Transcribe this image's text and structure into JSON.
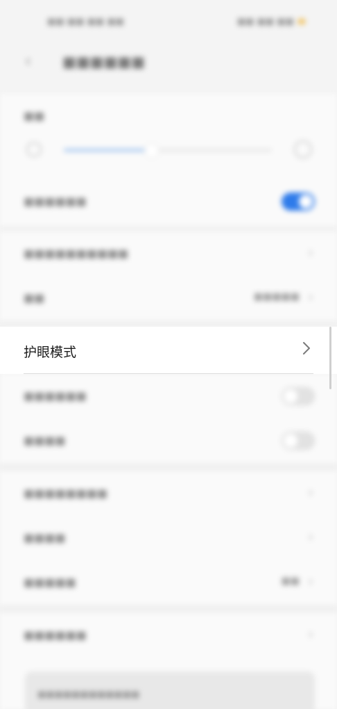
{
  "status_bar": {
    "time": "■■:■■ ■■ ■■",
    "icons": "■■ ■■  ■■"
  },
  "header": {
    "title": "■■■■■■"
  },
  "brightness": {
    "label": "■■",
    "level": 0.42
  },
  "auto_brightness": {
    "label": "■■■■■■",
    "on": true
  },
  "rows_top": [
    {
      "label": "■■■■■■■■■■",
      "value": ""
    },
    {
      "label": "■■",
      "value": "■■■■■"
    }
  ],
  "eye_comfort": {
    "label": "护眼模式"
  },
  "rows_mid": [
    {
      "label": "■■■■■■",
      "on": false
    },
    {
      "label": "■■■■",
      "on": false
    }
  ],
  "rows_bottom": [
    {
      "label": "■■■■■■■■",
      "value": ""
    },
    {
      "label": "■■■■",
      "value": ""
    },
    {
      "label": "■■■■■",
      "value": "■■"
    }
  ],
  "rows_last": [
    {
      "label": "■■■■■■",
      "value": ""
    }
  ],
  "info_box": {
    "text": "■■■■■■■■■■■■"
  },
  "colors": {
    "accent": "#2e7bea",
    "text_primary": "#1c1c1c",
    "background": "#f4f4f4"
  }
}
